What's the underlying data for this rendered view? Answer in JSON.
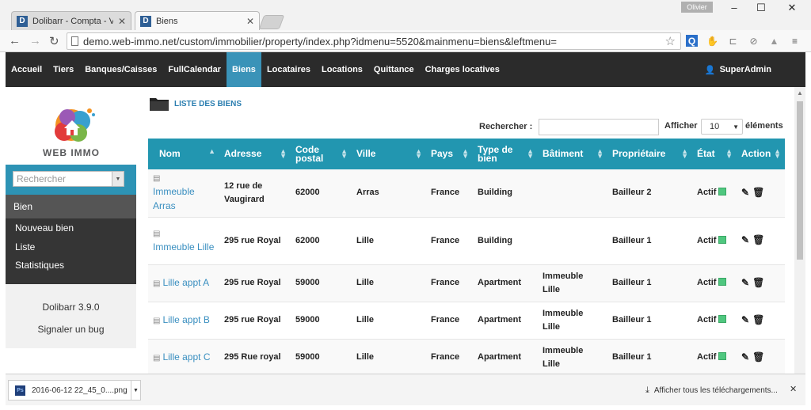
{
  "browser": {
    "tabs": [
      {
        "label": "Dolibarr - Compta - Venti",
        "active": false
      },
      {
        "label": "Biens",
        "active": true
      }
    ],
    "profile": "Olivier",
    "url": "demo.web-immo.net/custom/immobilier/property/index.php?idmenu=5520&mainmenu=biens&leftmenu=",
    "favicon_letter": "D"
  },
  "navbar": {
    "items": [
      "Accueil",
      "Tiers",
      "Banques/Caisses",
      "FullCalendar",
      "Biens",
      "Locataires",
      "Locations",
      "Quittance",
      "Charges locatives"
    ],
    "active": "Biens",
    "user": "SuperAdmin"
  },
  "sidebar": {
    "logo_text": "WEB IMMO",
    "search_placeholder": "Rechercher",
    "section": "Bien",
    "links": [
      "Nouveau bien",
      "Liste",
      "Statistiques"
    ],
    "version": "Dolibarr 3.9.0",
    "bug_link": "Signaler un bug"
  },
  "main": {
    "title": "LISTE DES BIENS",
    "search_label": "Rechercher :",
    "show_label": "Afficher",
    "show_value": "10",
    "show_suffix": "éléments",
    "columns": [
      "Nom",
      "Adresse",
      "Code postal",
      "Ville",
      "Pays",
      "Type de bien",
      "Bâtiment",
      "Propriétaire",
      "État",
      "Action"
    ],
    "rows": [
      {
        "nom": "Immeuble Arras",
        "adresse": "12 rue de Vaugirard",
        "code_postal": "62000",
        "ville": "Arras",
        "pays": "France",
        "type": "Building",
        "batiment": "",
        "proprietaire": "Bailleur 2",
        "etat": "Actif"
      },
      {
        "nom": "Immeuble Lille",
        "adresse": "295 rue Royal",
        "code_postal": "62000",
        "ville": "Lille",
        "pays": "France",
        "type": "Building",
        "batiment": "",
        "proprietaire": "Bailleur 1",
        "etat": "Actif"
      },
      {
        "nom": "Lille appt A",
        "adresse": "295 rue Royal",
        "code_postal": "59000",
        "ville": "Lille",
        "pays": "France",
        "type": "Apartment",
        "batiment": "Immeuble Lille",
        "proprietaire": "Bailleur 1",
        "etat": "Actif"
      },
      {
        "nom": "Lille appt B",
        "adresse": "295 rue Royal",
        "code_postal": "59000",
        "ville": "Lille",
        "pays": "France",
        "type": "Apartment",
        "batiment": "Immeuble Lille",
        "proprietaire": "Bailleur 1",
        "etat": "Actif"
      },
      {
        "nom": "Lille appt C",
        "adresse": "295 Rue royal",
        "code_postal": "59000",
        "ville": "Lille",
        "pays": "France",
        "type": "Apartment",
        "batiment": "Immeuble Lille",
        "proprietaire": "Bailleur 1",
        "etat": "Actif"
      }
    ]
  },
  "downloads": {
    "file": "2016-06-12 22_45_0....png",
    "show_all": "Afficher tous les téléchargements..."
  },
  "colors": {
    "navbar": "#2b2b2b",
    "accent": "#2296b0",
    "link": "#3a8fc0",
    "status_active": "#4fc77f"
  }
}
